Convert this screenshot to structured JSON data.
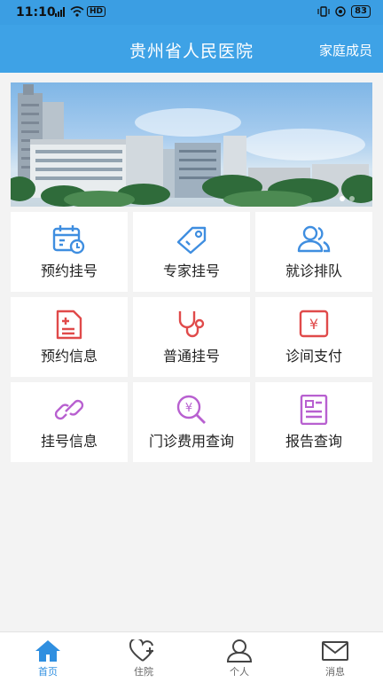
{
  "status_bar": {
    "time": "11:10",
    "network": "4G",
    "hd": "HD",
    "battery": "83"
  },
  "header": {
    "title": "贵州省人民医院",
    "family_members": "家庭成员"
  },
  "banner": {
    "dots": 2,
    "active_dot": 1
  },
  "services": [
    {
      "label": "预约挂号",
      "icon": "calendar-clock-icon",
      "color": "#3f8ee0"
    },
    {
      "label": "专家挂号",
      "icon": "tag-icon",
      "color": "#3f8ee0"
    },
    {
      "label": "就诊排队",
      "icon": "users-icon",
      "color": "#3f8ee0"
    },
    {
      "label": "预约信息",
      "icon": "document-plus-icon",
      "color": "#e04a4a"
    },
    {
      "label": "普通挂号",
      "icon": "stethoscope-icon",
      "color": "#e04a4a"
    },
    {
      "label": "诊间支付",
      "icon": "yuan-note-icon",
      "color": "#e04a4a"
    },
    {
      "label": "挂号信息",
      "icon": "link-icon",
      "color": "#b860d0"
    },
    {
      "label": "门诊费用查询",
      "icon": "yuan-search-icon",
      "color": "#b860d0"
    },
    {
      "label": "报告查询",
      "icon": "report-icon",
      "color": "#b860d0"
    }
  ],
  "bottom_nav": [
    {
      "label": "首页",
      "icon": "home-icon",
      "active": true
    },
    {
      "label": "住院",
      "icon": "heart-plus-icon",
      "active": false
    },
    {
      "label": "个人",
      "icon": "person-icon",
      "active": false
    },
    {
      "label": "消息",
      "icon": "mail-icon",
      "active": false
    }
  ],
  "colors": {
    "header": "#3ea2e6",
    "active": "#2f8fe0",
    "blue": "#3f8ee0",
    "red": "#e04a4a",
    "purple": "#b860d0"
  }
}
